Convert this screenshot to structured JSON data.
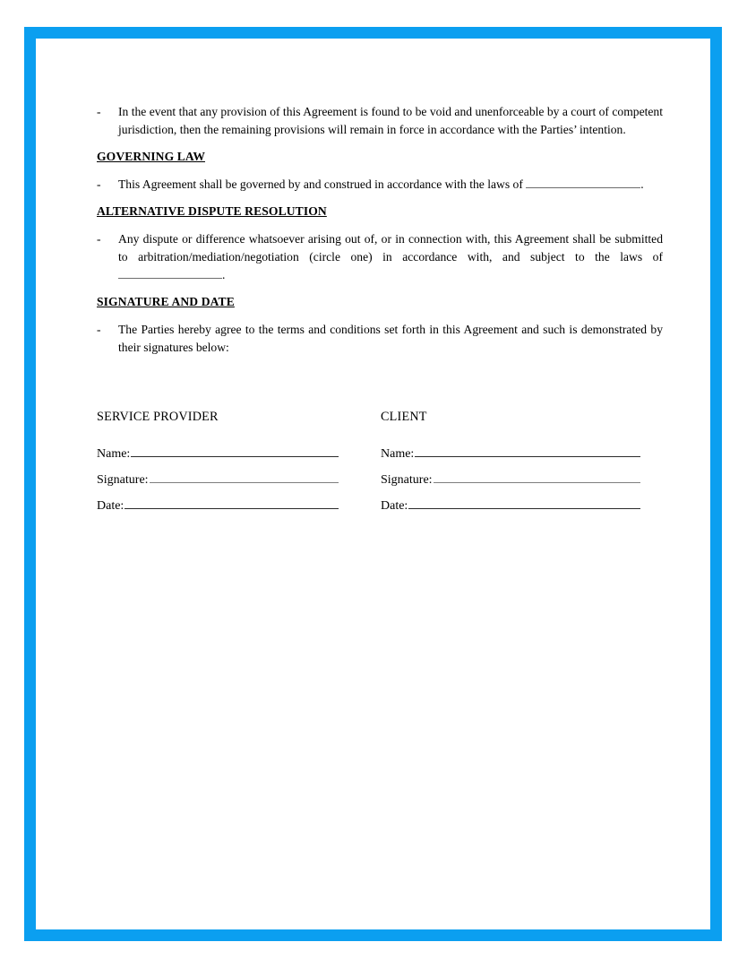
{
  "document": {
    "type": "agreement-signature-page",
    "border_color": "#0b9ff0",
    "page_background": "#ffffff",
    "text_color": "#000000"
  },
  "clauses": {
    "severability": {
      "bullet": "-",
      "text": "In the event that any provision of this Agreement is found to be void and unenforceable by a court of competent jurisdiction, then the remaining provisions will remain in force in accordance with the Parties’ intention."
    },
    "governing_law": {
      "heading": "GOVERNING LAW",
      "bullet": "-",
      "text_before_blank": "This Agreement shall be governed by and construed in accordance with the laws of",
      "blank_value": "",
      "text_after_blank": "."
    },
    "alternative_dispute_resolution": {
      "heading": "ALTERNATIVE DISPUTE RESOLUTION",
      "bullet": "-",
      "text_before_blank": "Any dispute or difference whatsoever arising out of, or in connection with, this Agreement shall be submitted to arbitration/mediation/negotiation (circle one) in accordance with, and subject to the laws of",
      "blank_value": "",
      "text_after_blank": "."
    },
    "signature_and_date": {
      "heading": "SIGNATURE AND DATE",
      "bullet": "-",
      "text": "The Parties hereby agree to the terms and conditions set forth in this Agreement and such is demonstrated by their signatures below:"
    }
  },
  "signature_block": {
    "parties": [
      {
        "title": "SERVICE PROVIDER",
        "fields": [
          {
            "label": "Name:",
            "value": ""
          },
          {
            "label": "Signature:",
            "value": ""
          },
          {
            "label": "Date:",
            "value": ""
          }
        ]
      },
      {
        "title": "CLIENT",
        "fields": [
          {
            "label": "Name:",
            "value": ""
          },
          {
            "label": "Signature:",
            "value": ""
          },
          {
            "label": "Date:",
            "value": ""
          }
        ]
      }
    ]
  }
}
